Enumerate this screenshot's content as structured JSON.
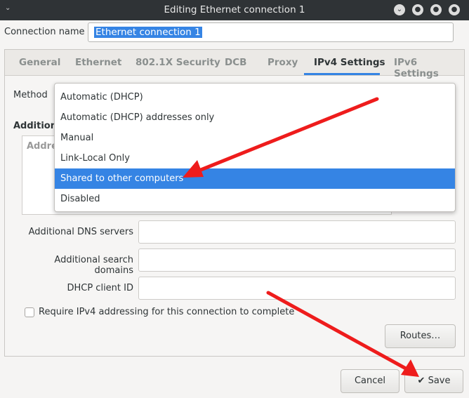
{
  "window": {
    "title": "Editing Ethernet connection 1"
  },
  "connection": {
    "label": "Connection name",
    "value": "Ethernet connection 1"
  },
  "tabs": [
    {
      "label": "General"
    },
    {
      "label": "Ethernet"
    },
    {
      "label": "802.1X Security"
    },
    {
      "label": "DCB"
    },
    {
      "label": "Proxy"
    },
    {
      "label": "IPv4 Settings"
    },
    {
      "label": "IPv6 Settings"
    }
  ],
  "ipv4": {
    "method_label": "Method",
    "method_options": [
      "Automatic (DHCP)",
      "Automatic (DHCP) addresses only",
      "Manual",
      "Link-Local Only",
      "Shared to other computers",
      "Disabled"
    ],
    "selected_option": "Shared to other computers",
    "additional_label": "Additiona",
    "addresses_placeholder": "Addres",
    "dns_label": "Additional DNS servers",
    "search_label": "Additional search domains",
    "dhcp_label": "DHCP client ID",
    "require_label": "Require IPv4 addressing for this connection to complete",
    "routes_button": "Routes…"
  },
  "footer": {
    "cancel": "Cancel",
    "save": "Save"
  },
  "colors": {
    "accent": "#3584e4",
    "arrow": "#ee1c1c",
    "titlebar": "#2f3336"
  },
  "icons": {
    "window_menu": "chevron-down-icon",
    "save": "checkmark-icon"
  }
}
